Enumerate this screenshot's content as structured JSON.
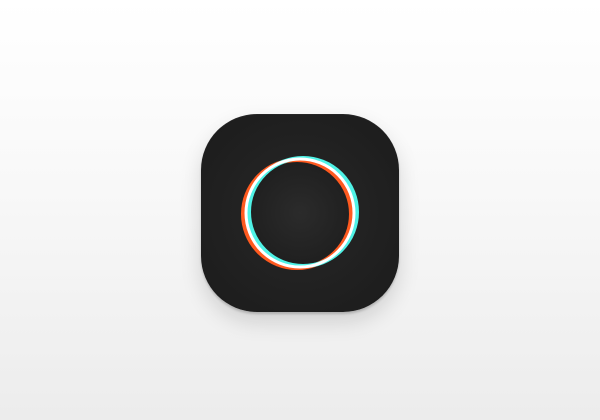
{
  "icon": {
    "name": "camera-shutter-ring-icon",
    "colors": {
      "page_background_top": "#ffffff",
      "page_background_bottom": "#ececec",
      "tile": "#222222",
      "ring_inner_fill": "#262626",
      "ring_orange": "#ff5a1f",
      "ring_cyan": "#4ff2e6",
      "ring_white": "#ffffff"
    }
  }
}
